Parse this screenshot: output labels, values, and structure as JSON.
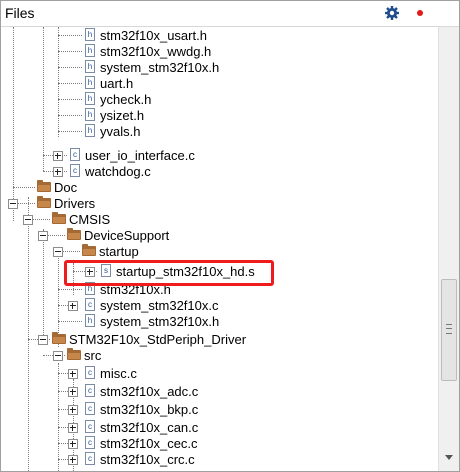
{
  "panel": {
    "title": "Files",
    "gear_icon": "gear-icon",
    "close_icon": "red-dot-icon",
    "accent_color": "#e21a1a",
    "highlight_color": "#ee1c1c"
  },
  "tree": {
    "rows": [
      {
        "label": "stm32f10x_usart.h",
        "icon": "h-file-icon"
      },
      {
        "label": "stm32f10x_wwdg.h",
        "icon": "h-file-icon"
      },
      {
        "label": "system_stm32f10x.h",
        "icon": "h-file-icon"
      },
      {
        "label": "uart.h",
        "icon": "h-file-icon"
      },
      {
        "label": "ycheck.h",
        "icon": "h-file-icon"
      },
      {
        "label": "ysizet.h",
        "icon": "h-file-icon"
      },
      {
        "label": "yvals.h",
        "icon": "h-file-icon"
      },
      {
        "label": "user_io_interface.c",
        "icon": "c-file-icon"
      },
      {
        "label": "watchdog.c",
        "icon": "c-file-icon"
      },
      {
        "label": "Doc",
        "icon": "folder-icon"
      },
      {
        "label": "Drivers",
        "icon": "folder-icon"
      },
      {
        "label": "CMSIS",
        "icon": "folder-icon"
      },
      {
        "label": "DeviceSupport",
        "icon": "folder-icon"
      },
      {
        "label": "startup",
        "icon": "folder-icon"
      },
      {
        "label": "startup_stm32f10x_hd.s",
        "icon": "s-file-icon"
      },
      {
        "label": "stm32f10x.h",
        "icon": "h-file-icon"
      },
      {
        "label": "system_stm32f10x.c",
        "icon": "c-file-icon"
      },
      {
        "label": "system_stm32f10x.h",
        "icon": "h-file-icon"
      },
      {
        "label": "STM32F10x_StdPeriph_Driver",
        "icon": "folder-icon"
      },
      {
        "label": "src",
        "icon": "folder-icon"
      },
      {
        "label": "misc.c",
        "icon": "c-file-icon"
      },
      {
        "label": "stm32f10x_adc.c",
        "icon": "c-file-icon"
      },
      {
        "label": "stm32f10x_bkp.c",
        "icon": "c-file-icon"
      },
      {
        "label": "stm32f10x_can.c",
        "icon": "c-file-icon"
      },
      {
        "label": "stm32f10x_cec.c",
        "icon": "c-file-icon"
      },
      {
        "label": "stm32f10x_crc.c",
        "icon": "c-file-icon"
      }
    ]
  }
}
